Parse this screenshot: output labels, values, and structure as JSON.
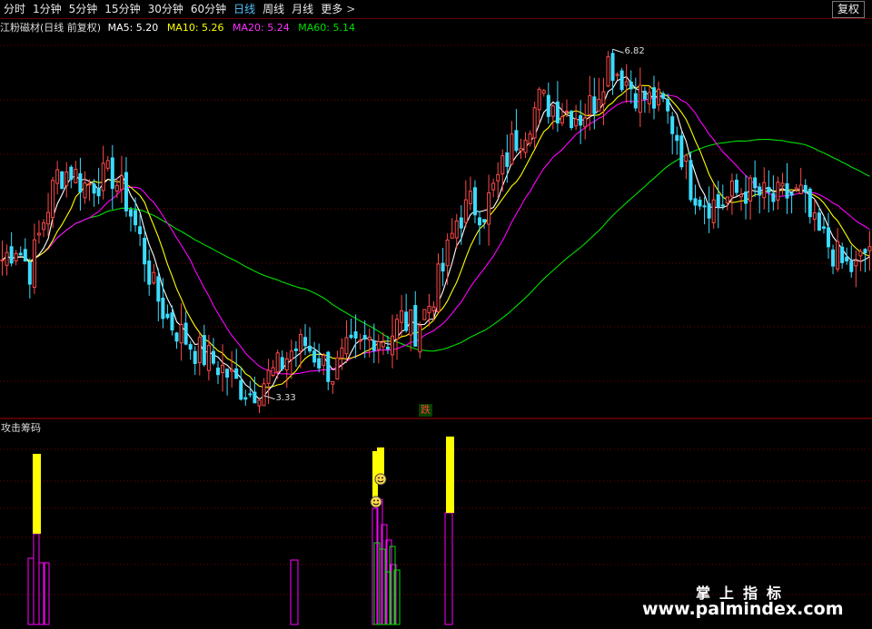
{
  "toolbar": {
    "tabs": [
      {
        "label": "分时",
        "active": false
      },
      {
        "label": "1分钟",
        "active": false
      },
      {
        "label": "5分钟",
        "active": false
      },
      {
        "label": "15分钟",
        "active": false
      },
      {
        "label": "30分钟",
        "active": false
      },
      {
        "label": "60分钟",
        "active": false
      },
      {
        "label": "日线",
        "active": true
      },
      {
        "label": "周线",
        "active": false
      },
      {
        "label": "月线",
        "active": false
      },
      {
        "label": "更多",
        "active": false
      }
    ],
    "restore_label": "复权"
  },
  "legend": {
    "stock_title": "江粉磁材(日线 前复权)",
    "ma5": "MA5: 5.20",
    "ma10": "MA10: 5.26",
    "ma20": "MA20: 5.24",
    "ma60": "MA60: 5.14"
  },
  "colors": {
    "up": "#ff4a4a",
    "down": "#3cdcff",
    "ma5": "#ffffff",
    "ma10": "#ffff00",
    "ma20": "#ff00ff",
    "ma60": "#00e000",
    "grid": "#7a0000"
  },
  "annotations": {
    "high_label": "6.82",
    "low_label": "3.33",
    "signal_label": "跌"
  },
  "indicator": {
    "title": "攻击筹码"
  },
  "watermark": {
    "cn": "掌上指标",
    "url": "www.palmindex.com"
  },
  "chart_data": [
    {
      "type": "candlestick",
      "title": "江粉磁材(日线 前复权)",
      "ylim": [
        3.2,
        6.95
      ],
      "series": [
        {
          "name": "MA5",
          "last": 5.2
        },
        {
          "name": "MA10",
          "last": 5.26
        },
        {
          "name": "MA20",
          "last": 5.24
        },
        {
          "name": "MA60",
          "last": 5.14
        }
      ],
      "close_path": [
        4.7,
        4.85,
        4.6,
        5.1,
        5.55,
        5.6,
        5.45,
        5.5,
        5.55,
        5.3,
        4.9,
        4.4,
        4.1,
        3.95,
        3.8,
        3.7,
        3.6,
        3.45,
        3.36,
        3.48,
        3.6,
        3.78,
        3.85,
        3.7,
        3.55,
        3.75,
        3.8,
        3.95,
        3.9,
        4.1,
        4.0,
        4.25,
        4.6,
        5.1,
        5.25,
        5.2,
        5.5,
        5.85,
        6.05,
        6.3,
        6.25,
        6.2,
        6.15,
        6.3,
        6.7,
        6.55,
        6.4,
        6.3,
        6.25,
        5.95,
        5.45,
        5.3,
        5.25,
        5.35,
        5.4,
        5.35,
        5.3,
        5.35,
        5.35,
        5.0,
        4.85,
        4.65,
        4.6,
        4.85
      ],
      "high": 6.82,
      "low": 3.33
    },
    {
      "type": "bar",
      "title": "攻击筹码",
      "note": "yellow caps = attack chips, magenta outline = base, green = inner"
    }
  ]
}
